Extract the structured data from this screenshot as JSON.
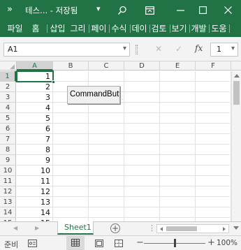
{
  "titlebar": {
    "title": "테스... - 저장됨",
    "more_glyph": "»",
    "dropdown_glyph": "▾",
    "search_glyph": "⚲",
    "ribbon_glyph": "⊡",
    "minimize_glyph": "—",
    "maximize_glyph": "☐",
    "close_glyph": "✕",
    "bg_color": "#217346"
  },
  "ribbon": {
    "tabs": [
      "파일",
      "홈",
      "삽입",
      "그리",
      "페이",
      "수식",
      "데이",
      "검토",
      "보기",
      "개발",
      "도움"
    ]
  },
  "formula_bar": {
    "name_box": "A1",
    "name_box_arrow": "▾",
    "cancel_glyph": "✕",
    "enter_glyph": "✓",
    "fx_label": "fx",
    "right_box": "1",
    "right_box_arrow": "▾"
  },
  "grid": {
    "columns": [
      "A",
      "B",
      "C",
      "D",
      "E",
      "F"
    ],
    "selected_column": "A",
    "rows": [
      "1",
      "2",
      "3",
      "4",
      "5",
      "6",
      "7",
      "8",
      "9",
      "10",
      "11",
      "12",
      "13",
      "14",
      "15"
    ],
    "selected_row": "1",
    "column_a_values": [
      "1",
      "2",
      "3",
      "4",
      "5",
      "6",
      "7",
      "8",
      "9",
      "10",
      "11",
      "12",
      "13",
      "14",
      "15"
    ],
    "command_button_label": "CommandButt"
  },
  "sheets": {
    "tabs": [
      "Sheet1"
    ],
    "active": "Sheet1",
    "add_glyph": "+",
    "prev_glyph": "◀",
    "next_glyph": "▶",
    "more_glyph": "⋮"
  },
  "status": {
    "ready_label": "준비",
    "zoom_minus": "−",
    "zoom_plus": "+",
    "zoom_level": "100%",
    "zoom_fraction": 0.5
  }
}
